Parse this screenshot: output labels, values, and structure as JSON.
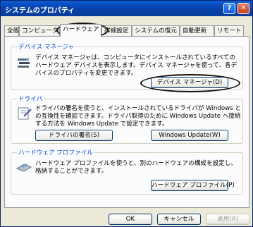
{
  "window": {
    "title": "システムのプロパティ",
    "help_glyph": "?",
    "close_glyph": "✕"
  },
  "tabs": [
    "全般",
    "コンピュータ名",
    "ハードウェア",
    "詳細設定",
    "システムの復元",
    "自動更新",
    "リモート"
  ],
  "device_manager": {
    "label": "デバイス マネージャ",
    "description": "デバイス マネージャは、コンピュータにインストールされているすべてのハードウェア デバイスを表示します。デバイス マネージャを使って、各デバイスのプロパティを変更できます。",
    "button": "デバイス マネージャ(D)"
  },
  "drivers": {
    "label": "ドライバ",
    "description": "ドライバの署名を使うと、インストールされているドライバが Windows との互換性を確認できます。ドライバ取得のために Windows Update へ接続する方法を Windows Update で設定できます。",
    "signing_button": "ドライバの署名(S)",
    "update_button": "Windows Update(W)"
  },
  "hw_profiles": {
    "label": "ハードウェア プロファイル",
    "description": "ハードウェア プロファイルを使うと、別のハードウェアの構成を設定し、格納することができます。",
    "button": "ハードウェア プロファイル(P)"
  },
  "footer": {
    "ok": "OK",
    "cancel": "キャンセル",
    "apply": "適用(A)"
  },
  "icons": [
    "device-manager-icon",
    "driver-signing-icon",
    "hardware-profile-icon",
    "help-icon",
    "close-icon"
  ]
}
